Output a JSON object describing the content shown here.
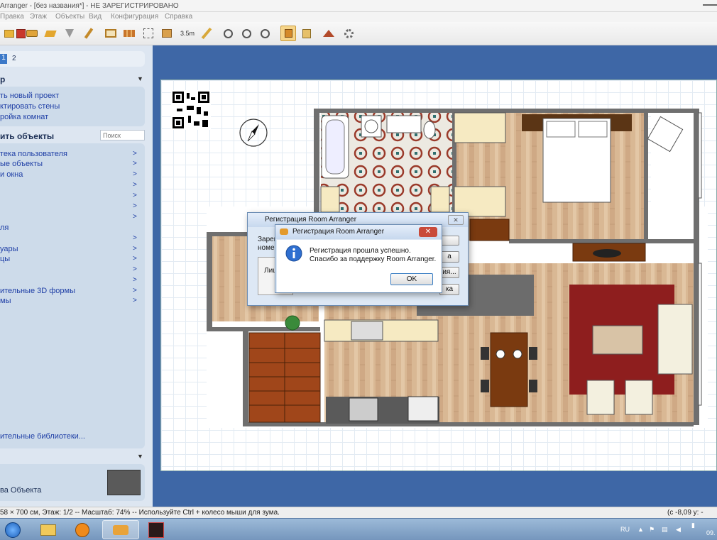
{
  "window": {
    "title": "Arranger - [без названия*] - НЕ ЗАРЕГИСТРИРОВАНО"
  },
  "menu": [
    "Правка",
    "Этаж",
    "Объекты",
    "Вид",
    "Конфигурация",
    "Справка"
  ],
  "toolbar": {
    "dimension_label": "3.5m",
    "icons": [
      "open-icon",
      "save-icon",
      "print-icon",
      "paint-icon",
      "select-icon",
      "brush-icon",
      "room-icon",
      "wall-icon",
      "resize-icon",
      "box-icon",
      "dimension-icon",
      "ruler-icon",
      "zoom-fit-icon",
      "zoom-in-icon",
      "zoom-out-icon",
      "2d-view-icon",
      "3d-objects-icon",
      "3d-house-icon",
      "settings-icon"
    ]
  },
  "sidebar": {
    "floor_tabs": [
      "1",
      "2"
    ],
    "section_tasks": {
      "title": "р",
      "items": [
        "ть новый проект",
        "ктировать стены",
        "ройка комнат"
      ]
    },
    "section_objects": {
      "title": "ить объекты",
      "search_placeholder": "Поиск",
      "items": [
        {
          "label": "тека пользователя"
        },
        {
          "label": "ые объекты"
        },
        {
          "label": "и окна"
        },
        {
          "label": ""
        },
        {
          "label": ""
        },
        {
          "label": ""
        },
        {
          "label": "ля"
        },
        {
          "label": ""
        },
        {
          "label": "уары"
        },
        {
          "label": "цы"
        },
        {
          "label": ""
        },
        {
          "label": ""
        },
        {
          "label": "ительные 3D формы"
        },
        {
          "label": "мы"
        }
      ],
      "extra_libraries": "ительные библиотеки..."
    },
    "section_props": {
      "label": "ва Объекта",
      "swatch_color": "#5a5a5a"
    }
  },
  "status": {
    "left": "58 × 700 см, Этаж: 1/2 -- Масштаб: 74% -- Используйте Ctrl + колесо мыши для зума.",
    "right": "(c -8,09 у: -"
  },
  "dialog_back": {
    "title": "Регистрация Room Arranger",
    "text1": "Зарег",
    "text2": "номер",
    "field_label": "Лиц",
    "button_labels": [
      "",
      "а",
      "ия...",
      "ка"
    ]
  },
  "dialog_front": {
    "title": "Регистрация Room Arranger",
    "line1": "Регистрация прошла успешно.",
    "line2": "Спасибо за поддержку Room Arranger.",
    "ok_label": "OK"
  },
  "taskbar": {
    "lang": "RU",
    "clock": "09.",
    "apps": [
      "ie-icon",
      "explorer-icon",
      "media-player-icon",
      "room-arranger-icon",
      "game-icon"
    ]
  }
}
